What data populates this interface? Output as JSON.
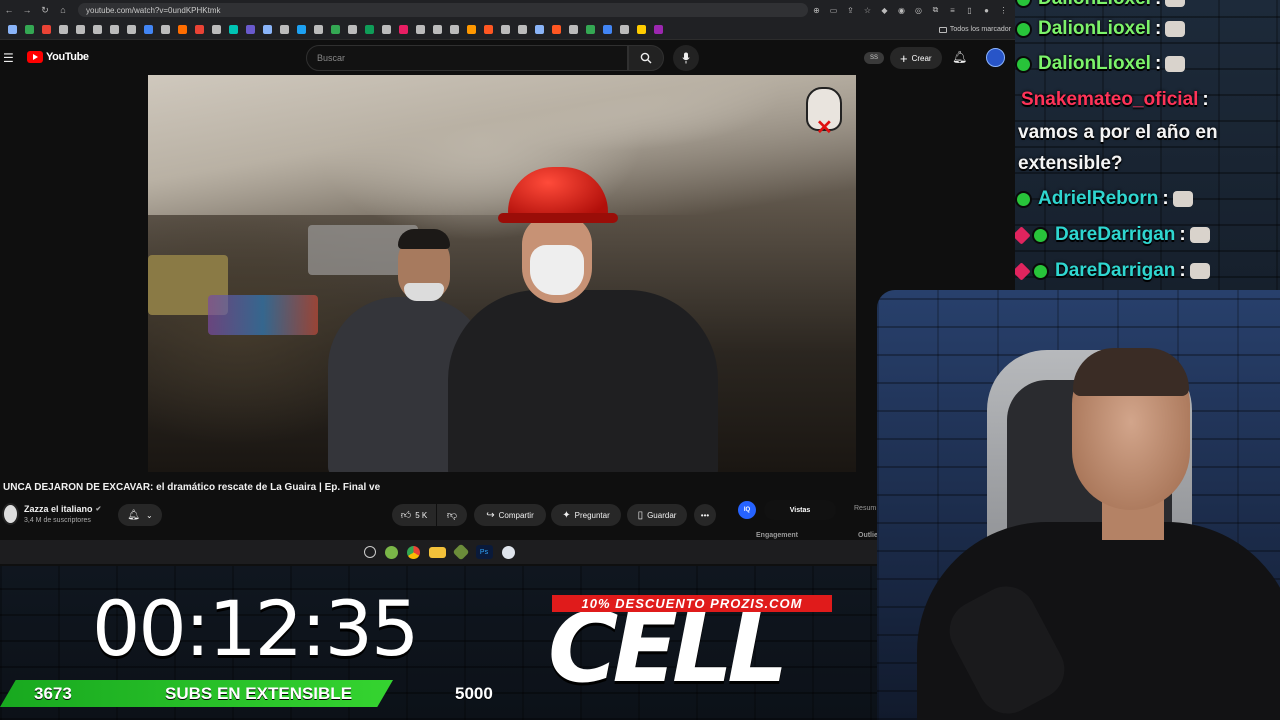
{
  "browser": {
    "url": "youtube.com/watch?v=0undKPHKtmk",
    "bookmarks_all_label": "Todos los marcador",
    "bookmark_colors": [
      "#8ab4f8",
      "#34a853",
      "#ea4335",
      "#bbbbbb",
      "#bbbbbb",
      "#bbbbbb",
      "#bbbbbb",
      "#bbbbbb",
      "#4285f4",
      "#bbbbbb",
      "#ff6d00",
      "#ea4335",
      "#bbbbbb",
      "#00c4b4",
      "#6a5acd",
      "#8ab4f8",
      "#bbbbbb",
      "#1da1f2",
      "#bbbbbb",
      "#34a853",
      "#bbbbbb",
      "#0f9d58",
      "#bbbbbb",
      "#e91e63",
      "#bbbbbb",
      "#bbbbbb",
      "#bbbbbb",
      "#ff9800",
      "#ff5722",
      "#bbbbbb",
      "#bbbbbb",
      "#8ab4f8",
      "#ff5722",
      "#bbbbbb",
      "#34a853",
      "#4285f4",
      "#bbbbbb",
      "#ffcc00",
      "#9c27b0"
    ]
  },
  "youtube": {
    "logo_text": "YouTube",
    "search_placeholder": "Buscar",
    "ss_badge": "SS",
    "create_label": "Crear",
    "video_title": "UNCA DEJARON DE EXCAVAR: el dramático rescate de La Guaira | Ep. Final ve",
    "channel_name": "Zazza el italiano",
    "subscribers": "3,4 M de suscriptores",
    "like_count": "5 K",
    "share_label": "Compartir",
    "ask_label": "Preguntar",
    "save_label": "Guardar",
    "panel": {
      "logo": "IQ",
      "tab_active": "Vistas",
      "tab_other": "Resum",
      "engagement_label": "Engagement",
      "outlier_label": "Outlie"
    }
  },
  "chat": {
    "lines": [
      {
        "user": "DalionLioxel",
        "color": "#7cf36a",
        "separator": ":"
      },
      {
        "user": "DalionLioxel",
        "color": "#7cf36a",
        "separator": ":"
      },
      {
        "user": "DalionLioxel",
        "color": "#7cf36a",
        "separator": ":"
      },
      {
        "user": "Snakemateo_oficial",
        "color": "#ff3358",
        "separator": ":"
      },
      {
        "user": "AdrielReborn",
        "color": "#2fd6d0",
        "separator": ":"
      },
      {
        "user": "DareDarrigan",
        "color": "#2fd6d0",
        "separator": ":"
      },
      {
        "user": "DareDarrigan",
        "color": "#2fd6d0",
        "separator": ":"
      }
    ],
    "message": "vamos a por el año en extensible?"
  },
  "overlay": {
    "timer": "00:12:35",
    "subs_current": "3673",
    "subs_label": "SUBS EN EXTENSIBLE",
    "subs_goal": "5000",
    "subs_progress": 0.7346,
    "promo_tag": "10% DESCUENTO PROZIS.COM",
    "promo_brand": "CELL"
  }
}
